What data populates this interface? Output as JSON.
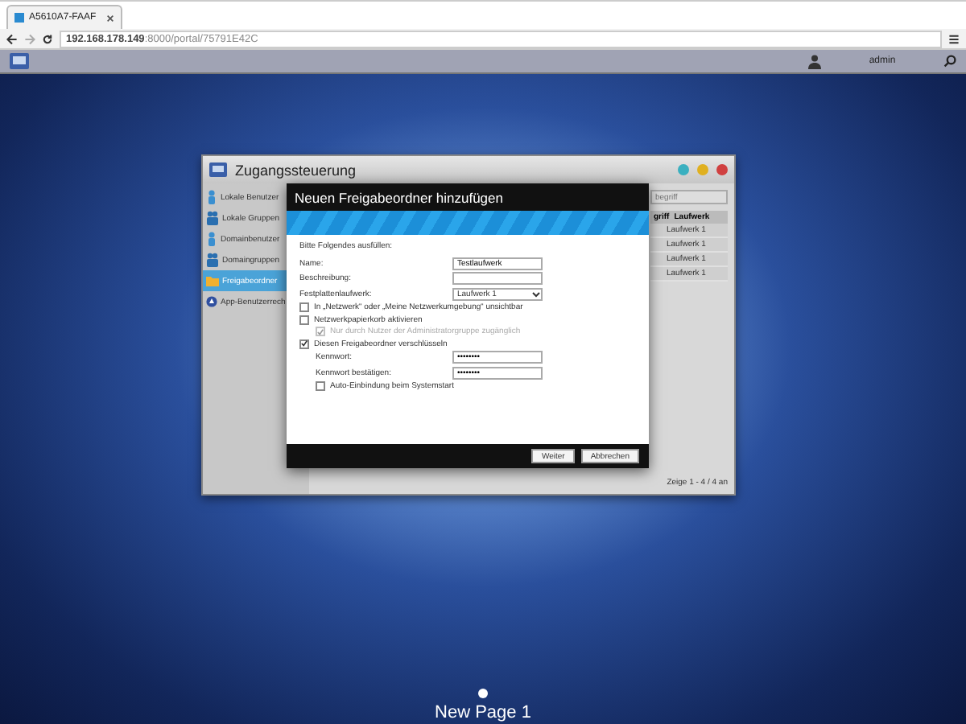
{
  "browser": {
    "tab_title": "A5610A7-FAAF",
    "url_host": "192.168.178.149",
    "url_rest": ":8000/portal/75791E42C"
  },
  "top_bar": {
    "user": "admin"
  },
  "window": {
    "title": "Zugangssteuerung",
    "sidebar": [
      {
        "label": "Lokale Benutzer",
        "kind": "user",
        "selected": false
      },
      {
        "label": "Lokale Gruppen",
        "kind": "group",
        "selected": false
      },
      {
        "label": "Domainbenutzer",
        "kind": "user",
        "selected": false
      },
      {
        "label": "Domaingruppen",
        "kind": "group",
        "selected": false
      },
      {
        "label": "Freigabeordner",
        "kind": "folder",
        "selected": true
      },
      {
        "label": "App-Benutzerrech",
        "kind": "app",
        "selected": false
      }
    ],
    "search": {
      "placeholder": "begriff"
    },
    "table": {
      "columns": [
        "griff",
        "Laufwerk"
      ],
      "rows": [
        [
          "Laufwerk 1"
        ],
        [
          "Laufwerk 1"
        ],
        [
          "Laufwerk 1"
        ],
        [
          "Laufwerk 1"
        ]
      ]
    },
    "footer": "Zeige 1 - 4 / 4 an"
  },
  "dialog": {
    "title": "Neuen Freigabeordner hinzufügen",
    "intro": "Bitte Folgendes ausfüllen:",
    "fields": [
      {
        "label": "Name:",
        "kind": "text",
        "value": "Testlaufwerk"
      },
      {
        "label": "Beschreibung:",
        "kind": "text"
      },
      {
        "label": "Festplattenlaufwerk:",
        "kind": "select",
        "value": "Laufwerk 1"
      }
    ],
    "options": [
      {
        "label": "In „Netzwerk“ oder „Meine Netzwerkumgebung“ unsichtbar",
        "checked": false,
        "disabled": false,
        "indent": false
      },
      {
        "label": "Netzwerkpapierkorb aktivieren",
        "checked": false,
        "disabled": false,
        "indent": false
      },
      {
        "label": "Nur durch Nutzer der Administratorgruppe zugänglich",
        "checked": true,
        "disabled": true,
        "indent": true
      },
      {
        "label": "Diesen Freigabeordner verschlüsseln",
        "checked": true,
        "disabled": false,
        "indent": false
      }
    ],
    "passwords": [
      {
        "label": "Kennwort:",
        "value": "••••••••"
      },
      {
        "label": "Kennwort bestätigen:",
        "value": "••••••••"
      }
    ],
    "automount": {
      "label": "Auto-Einbindung beim Systemstart",
      "checked": false
    },
    "buttons": [
      "Weiter",
      "Abbrechen"
    ]
  },
  "page_label": "New Page 1"
}
